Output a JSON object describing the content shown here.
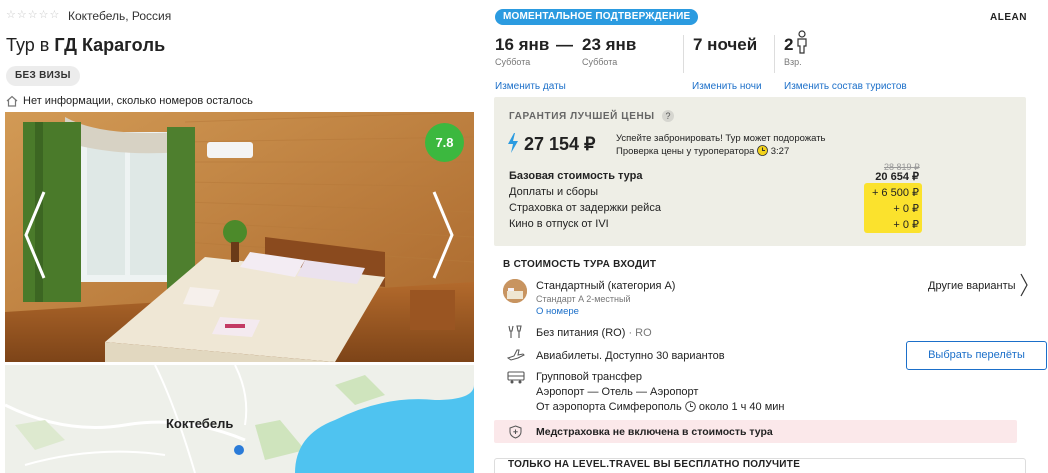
{
  "hotel": {
    "stars": 5,
    "location": "Коктебель, Россия",
    "title_prefix": "Тур в",
    "title_name": "ГД Карагoль",
    "visa_badge": "БЕЗ ВИЗЫ",
    "rooms_info": "Нет информации, сколько номеров осталось",
    "rating": "7.8",
    "map_label": "Коктебель"
  },
  "offer": {
    "instant_badge": "МОМЕНТАЛЬНОЕ ПОДТВЕРЖДЕНИЕ",
    "operator": "ALEAN",
    "date_from": "16 янв",
    "day_from": "Суббота",
    "date_to": "23 янв",
    "day_to": "Суббота",
    "nights": "7 ночей",
    "adults": "2",
    "adults_label": "Взр.",
    "change_dates": "Изменить даты",
    "change_nights": "Изменить ночи",
    "change_tourists": "Изменить состав туристов"
  },
  "price": {
    "guarantee": "ГАРАНТИЯ ЛУЧШЕЙ ЦЕНЫ",
    "guarantee_q": "?",
    "total": "27 154 ₽",
    "hurry_line1": "Успейте забронировать! Тур может подорожать",
    "hurry_line2": "Проверка цены у туроператора",
    "timer": "3:27",
    "rows": [
      {
        "label": "Базовая стоимость тура",
        "value": "20 654 ₽"
      },
      {
        "label": "Доплаты и сборы",
        "value": "+ 6 500 ₽"
      },
      {
        "label": "Страховка от задержки рейса",
        "value": "+ 0 ₽"
      },
      {
        "label": "Кино в отпуск от IVI",
        "value": "+ 0 ₽"
      }
    ],
    "old_price": "28 819 ₽"
  },
  "includes": {
    "heading": "В СТОИМОСТЬ ТУРА ВХОДИТ",
    "room_name": "Стандартный (категория A)",
    "room_sub": "Стандарт A 2-местный",
    "room_link": "О номере",
    "other_variants": "Другие варианты",
    "meal": "Без питания (RO)",
    "meal_code": "· RO",
    "flights": "Авиабилеты. Доступно 30 вариантов",
    "flights_button": "Выбрать перелёты",
    "transfer_title": "Групповой трансфер",
    "transfer_route": "Аэропорт — Отель — Аэропорт",
    "transfer_from": "От аэропорта Симферополь",
    "transfer_time": "около 1 ч 40 мин",
    "insurance": "Медстраховка не включена в стоимость тура",
    "free_heading": "ТОЛЬКО НА LEVEL.TRAVEL ВЫ БЕСПЛАТНО ПОЛУЧИТЕ"
  },
  "colors": {
    "accent_blue": "#1b6fc9",
    "badge_blue": "#2b9be0",
    "rating_green": "#3cb83f",
    "highlight_yellow": "#fbe22d",
    "price_box_bg": "#eeeee6",
    "insurance_bg": "#fbe8ea"
  }
}
